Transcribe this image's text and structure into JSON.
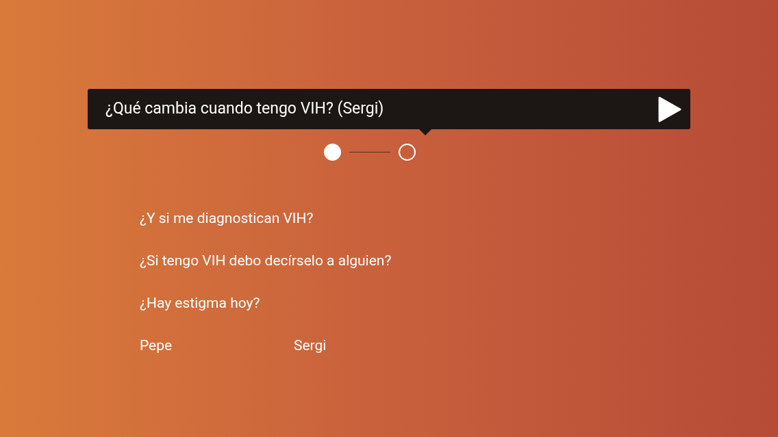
{
  "banner": {
    "title": "¿Qué cambia cuando tengo VIH? (Sergi)"
  },
  "pager": [
    {
      "selected": true
    },
    {
      "selected": false
    }
  ],
  "questions": [
    "¿Y si me diagnostican VIH?",
    "¿Si tengo VIH debo decírselo a alguien?",
    "¿Hay estigma hoy?"
  ],
  "people": [
    "Pepe",
    "Sergi"
  ]
}
